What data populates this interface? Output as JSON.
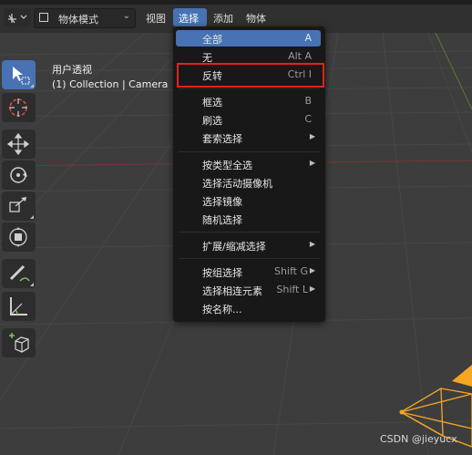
{
  "header": {
    "editor_type_icon": "3d-viewport-icon",
    "mode_dropdown": {
      "icon": "object-mode-icon",
      "label": "物体模式"
    },
    "menus": [
      "视图",
      "选择",
      "添加",
      "物体"
    ],
    "active_menu": "选择"
  },
  "viewport_info": {
    "view_name": "用户透视",
    "collection_line": "(1) Collection | Camera"
  },
  "toolbar": {
    "tools": [
      {
        "name": "select-box-icon",
        "active": true
      },
      {
        "name": "cursor-icon",
        "active": false
      },
      {
        "name": "move-icon",
        "active": false
      },
      {
        "name": "rotate-icon",
        "active": false
      },
      {
        "name": "scale-icon",
        "active": false
      },
      {
        "name": "transform-icon",
        "active": false
      },
      {
        "name": "annotate-icon",
        "active": false
      },
      {
        "name": "measure-icon",
        "active": false
      },
      {
        "name": "add-cube-icon",
        "active": false
      }
    ]
  },
  "select_menu": {
    "items": [
      {
        "label": "全部",
        "shortcut": "A",
        "highlighted": true
      },
      {
        "label": "无",
        "shortcut": "Alt A"
      },
      {
        "label": "反转",
        "shortcut": "Ctrl I"
      },
      {
        "label": "框选",
        "shortcut": "B"
      },
      {
        "label": "刷选",
        "shortcut": "C"
      },
      {
        "label": "套索选择",
        "shortcut": "",
        "submenu": true
      },
      {
        "label": "按类型全选",
        "shortcut": "",
        "submenu": true
      },
      {
        "label": "选择活动摄像机",
        "shortcut": ""
      },
      {
        "label": "选择镜像",
        "shortcut": ""
      },
      {
        "label": "随机选择",
        "shortcut": ""
      },
      {
        "label": "扩展/缩减选择",
        "shortcut": "",
        "submenu": true
      },
      {
        "label": "按组选择",
        "shortcut": "Shift G",
        "submenu": true
      },
      {
        "label": "选择相连元素",
        "shortcut": "Shift L",
        "submenu": true
      },
      {
        "label": "按名称...",
        "shortcut": ""
      }
    ]
  },
  "annotation": {
    "highlight_item": "反转",
    "color": "#e2231a"
  },
  "watermark": "CSDN @jieyucx",
  "colors": {
    "accent": "#4772b3",
    "menu_bg": "#181818",
    "viewport_bg": "#3d3d3d",
    "camera_orange": "#f5a623"
  }
}
